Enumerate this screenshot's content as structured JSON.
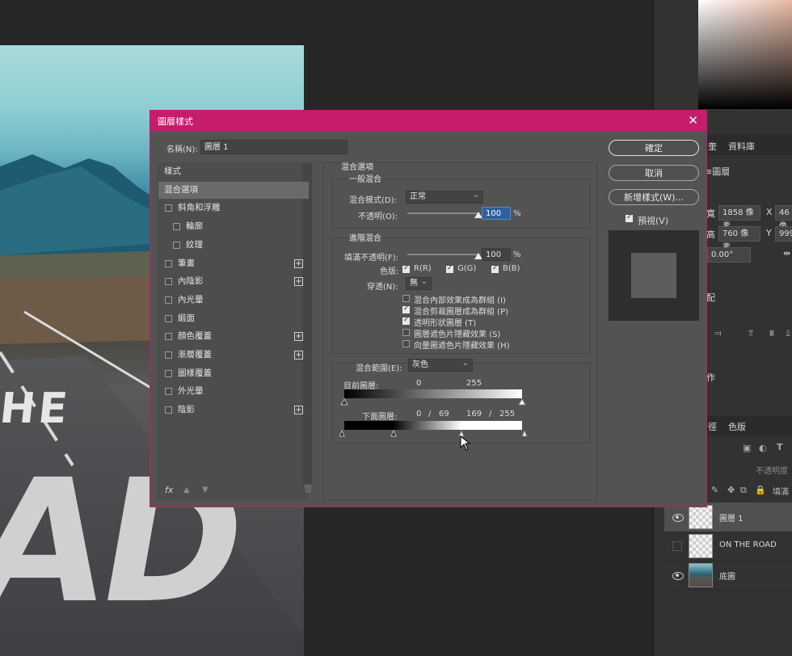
{
  "canvas": {
    "road_text_line1": "HE",
    "road_text_line2": "AD"
  },
  "right_panel": {
    "tab_library": "資料庫",
    "tab_partial": "奎",
    "layer_props_title_partial": "≡圖層",
    "w_label": "寬",
    "w_value": "1858 像素",
    "h_label": "高",
    "h_value": "760 像素",
    "x_label": "X",
    "x_value": "46 像",
    "y_label": "Y",
    "y_value": "999",
    "angle_value": "0.00°",
    "align_label_partial": "配",
    "actions_label_partial": "作",
    "tab_color": "色版",
    "tab_paths_partial": "徑",
    "opacity_label_partial": "不透明度",
    "fill_label_partial": "填滿",
    "layers": [
      {
        "name": "圖層 1",
        "visible": true,
        "selected": true
      },
      {
        "name": "ON THE ROAD",
        "visible": false,
        "selected": false
      },
      {
        "name": "底圖",
        "visible": true,
        "selected": false
      }
    ]
  },
  "dialog": {
    "title": "圖層樣式",
    "close_glyph": "✕",
    "name_label": "名稱(N):",
    "name_value": "圖層 1",
    "style_list": [
      {
        "label": "樣式",
        "checkbox": false,
        "plus": false,
        "indent": 0,
        "selected": false
      },
      {
        "label": "混合選項",
        "checkbox": false,
        "plus": false,
        "indent": 0,
        "selected": true
      },
      {
        "label": "斜角和浮雕",
        "checkbox": true,
        "plus": false,
        "indent": 0,
        "selected": false
      },
      {
        "label": "輪廓",
        "checkbox": true,
        "plus": false,
        "indent": 1,
        "selected": false
      },
      {
        "label": "紋理",
        "checkbox": true,
        "plus": false,
        "indent": 1,
        "selected": false
      },
      {
        "label": "筆畫",
        "checkbox": true,
        "plus": true,
        "indent": 0,
        "selected": false
      },
      {
        "label": "內陰影",
        "checkbox": true,
        "plus": true,
        "indent": 0,
        "selected": false
      },
      {
        "label": "內光暈",
        "checkbox": true,
        "plus": false,
        "indent": 0,
        "selected": false
      },
      {
        "label": "緞面",
        "checkbox": true,
        "plus": false,
        "indent": 0,
        "selected": false
      },
      {
        "label": "顏色覆蓋",
        "checkbox": true,
        "plus": true,
        "indent": 0,
        "selected": false
      },
      {
        "label": "漸層覆蓋",
        "checkbox": true,
        "plus": true,
        "indent": 0,
        "selected": false
      },
      {
        "label": "圖樣覆蓋",
        "checkbox": true,
        "plus": false,
        "indent": 0,
        "selected": false
      },
      {
        "label": "外光暈",
        "checkbox": true,
        "plus": false,
        "indent": 0,
        "selected": false
      },
      {
        "label": "陰影",
        "checkbox": true,
        "plus": true,
        "indent": 0,
        "selected": false
      }
    ],
    "footer": {
      "fx": "fx",
      "up": "▲",
      "down": "▼",
      "trash": "🗑"
    },
    "blending": {
      "section_title": "混合選項",
      "general_title": "一般混合",
      "blend_mode_label": "混合模式(D):",
      "blend_mode_value": "正常",
      "opacity_label": "不透明(O):",
      "opacity_value": "100",
      "opacity_fraction": 1.0,
      "percent": "%",
      "advanced_title": "進階混合",
      "fill_opacity_label": "填滿不透明(F):",
      "fill_opacity_value": "100",
      "fill_opacity_fraction": 1.0,
      "channels_label": "色版:",
      "channels": [
        {
          "label": "R(R)",
          "checked": true
        },
        {
          "label": "G(G)",
          "checked": true
        },
        {
          "label": "B(B)",
          "checked": true
        }
      ],
      "knockout_label": "穿透(N):",
      "knockout_value": "無",
      "options": [
        {
          "label": "混合內部效果成為群組 (I)",
          "checked": false
        },
        {
          "label": "混合剪裁圖層成為群組 (P)",
          "checked": true
        },
        {
          "label": "透明形狀圖層 (T)",
          "checked": true
        },
        {
          "label": "圖層遮色片隱藏效果 (S)",
          "checked": false
        },
        {
          "label": "向量圖遮色片隱藏效果 (H)",
          "checked": false
        }
      ],
      "blend_if_label": "混合範圍(E):",
      "blend_if_value": "灰色",
      "this_layer_label": "目前圖層:",
      "this_layer_low": "0",
      "this_layer_high": "255",
      "underlying_label": "下面圖層:",
      "underlying_values": [
        "0",
        "/",
        "69",
        "169",
        "/",
        "255"
      ]
    },
    "buttons": {
      "ok": "確定",
      "cancel": "取消",
      "new_style": "新增樣式(W)...",
      "preview_label": "預視(V)",
      "preview_checked": true
    }
  },
  "colors": {
    "dialog_accent": "#c51c6b",
    "dialog_bg": "#535353",
    "app_bg": "#262626"
  }
}
